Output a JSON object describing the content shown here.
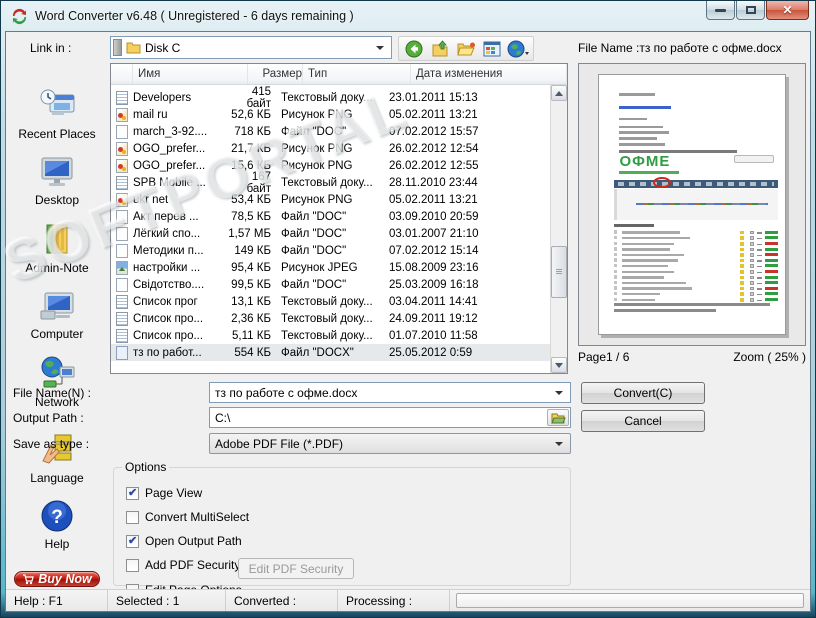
{
  "window": {
    "title": "Word Converter v6.48 ( Unregistered - 6 days remaining )"
  },
  "toolbar": {
    "link_in_label": "Link in :",
    "location_value": "Disk C",
    "icons": [
      "back-icon",
      "up-folder-icon",
      "open-folder-icon",
      "views-icon",
      "web-icon"
    ]
  },
  "sidebar": {
    "items": [
      {
        "label": "Recent Places"
      },
      {
        "label": "Desktop"
      },
      {
        "label": "Admin-Note"
      },
      {
        "label": "Computer"
      },
      {
        "label": "Network"
      },
      {
        "label": "Language"
      },
      {
        "label": "Help"
      }
    ],
    "buy_now_label": "Buy Now"
  },
  "file_list": {
    "columns": [
      "Имя",
      "Размер",
      "Тип",
      "Дата изменения"
    ],
    "rows": [
      {
        "name": "Developers",
        "size": "415 байт",
        "type": "Текстовый доку...",
        "date": "23.01.2011 15:13",
        "icon": "text",
        "selected": false
      },
      {
        "name": "mail ru",
        "size": "52,6 КБ",
        "type": "Рисунок PNG",
        "date": "05.02.2011 13:21",
        "icon": "image",
        "selected": false
      },
      {
        "name": "march_3-92....",
        "size": "718 КБ",
        "type": "Файл \"DOC\"",
        "date": "07.02.2012 15:57",
        "icon": "doc",
        "selected": false
      },
      {
        "name": "OGO_prefer...",
        "size": "21,7 КБ",
        "type": "Рисунок PNG",
        "date": "26.02.2012 12:54",
        "icon": "image",
        "selected": false
      },
      {
        "name": "OGO_prefer...",
        "size": "15,6 КБ",
        "type": "Рисунок PNG",
        "date": "26.02.2012 12:55",
        "icon": "image",
        "selected": false
      },
      {
        "name": "SPB Mobile ...",
        "size": "167 байт",
        "type": "Текстовый доку...",
        "date": "28.11.2010 23:44",
        "icon": "text",
        "selected": false
      },
      {
        "name": "ukr net",
        "size": "53,4 КБ",
        "type": "Рисунок PNG",
        "date": "05.02.2011 13:21",
        "icon": "image",
        "selected": false
      },
      {
        "name": "Акт перев ...",
        "size": "78,5 КБ",
        "type": "Файл \"DOC\"",
        "date": "03.09.2010 20:59",
        "icon": "doc",
        "selected": false
      },
      {
        "name": "Лёгкий спо...",
        "size": "1,57 МБ",
        "type": "Файл \"DOC\"",
        "date": "03.01.2007 21:10",
        "icon": "doc",
        "selected": false
      },
      {
        "name": "Методики п...",
        "size": "149 КБ",
        "type": "Файл \"DOC\"",
        "date": "07.02.2012 15:14",
        "icon": "doc",
        "selected": false
      },
      {
        "name": "настройки ...",
        "size": "95,4 КБ",
        "type": "Рисунок JPEG",
        "date": "15.08.2009 23:16",
        "icon": "jpeg",
        "selected": false
      },
      {
        "name": "Свідотство....",
        "size": "99,5 КБ",
        "type": "Файл \"DOC\"",
        "date": "25.03.2009 16:18",
        "icon": "doc",
        "selected": false
      },
      {
        "name": "Список прог",
        "size": "13,1 КБ",
        "type": "Текстовый доку...",
        "date": "03.04.2011 14:41",
        "icon": "text",
        "selected": false
      },
      {
        "name": "Список про...",
        "size": "2,36 КБ",
        "type": "Текстовый доку...",
        "date": "24.09.2011 19:12",
        "icon": "text",
        "selected": false
      },
      {
        "name": "Список про...",
        "size": "5,11 КБ",
        "type": "Текстовый доку...",
        "date": "01.07.2010 11:58",
        "icon": "text",
        "selected": false
      },
      {
        "name": "тз по работ...",
        "size": "554 КБ",
        "type": "Файл \"DOCX\"",
        "date": "25.05.2012 0:59",
        "icon": "docx",
        "selected": true
      }
    ]
  },
  "preview": {
    "file_name_label": "File Name :тз по работе с офме.docx",
    "logo_text": "ОФМЕ",
    "page_label": "Page1 / 6",
    "zoom_label": "Zoom ( 25% )"
  },
  "form": {
    "file_name_label": "File Name(N) :",
    "file_name_value": "тз по работе с офме.docx",
    "output_path_label": "Output Path :",
    "output_path_value": "C:\\",
    "save_as_type_label": "Save as type :",
    "save_as_type_value": "Adobe PDF File (*.PDF)"
  },
  "options": {
    "group_label": "Options",
    "checkboxes": [
      {
        "label": "Page View",
        "checked": true
      },
      {
        "label": "Convert MultiSelect",
        "checked": false
      },
      {
        "label": "Open Output Path",
        "checked": true
      },
      {
        "label": "Add PDF Security",
        "checked": false
      },
      {
        "label": "Edit Page Options",
        "checked": false
      }
    ],
    "edit_pdf_security_label": "Edit PDF Security"
  },
  "actions": {
    "convert_label": "Convert(C)",
    "cancel_label": "Cancel"
  },
  "status_bar": {
    "help": "Help : F1",
    "selected": "Selected : 1",
    "converted": "Converted :",
    "processing": "Processing :"
  },
  "watermark": "SOFTPORTAL"
}
